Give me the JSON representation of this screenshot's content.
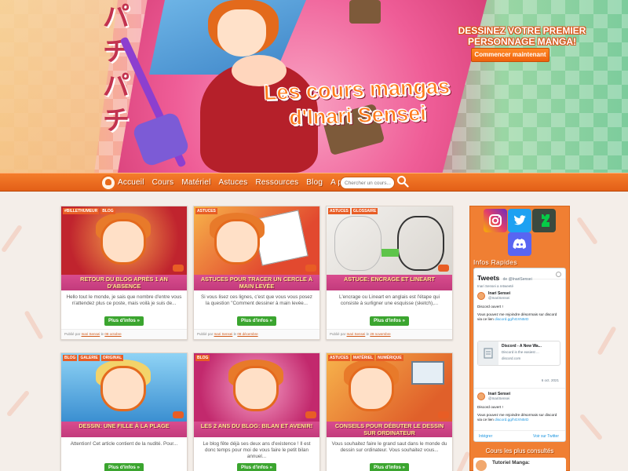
{
  "hero": {
    "title_line1": "Les cours mangas",
    "title_line2": "d'Inari Sensei",
    "cta_text_line1": "DESSINEZ VOTRE PREMIER",
    "cta_text_line2": "PERSONNAGE MANGA!",
    "cta_button": "Commencer maintenant",
    "kana": "パチパチ"
  },
  "nav": {
    "items": [
      "Accueil",
      "Cours",
      "Matériel",
      "Astuces",
      "Ressources",
      "Blog",
      "A propos"
    ],
    "search_placeholder": "Chercher un cours..."
  },
  "posts": [
    {
      "tags": [
        "#BILLETHUMEUR",
        "BLOG"
      ],
      "title": "Retour du blog après 1 an d'absence",
      "excerpt": "Hello tout le monde, je sais que nombre d'entre vous n'attendez plus ce poste, mais voilà je suis de...",
      "more": "Plus d'infos »",
      "meta_prefix": "Publié par",
      "author": "Inari Sensei",
      "meta_sep": "le",
      "date": "08 octobre",
      "colors": {
        "bg1": "#f5a04a",
        "bg2": "#c0242e"
      }
    },
    {
      "tags": [
        "ASTUCES"
      ],
      "title": "Astuces pour tracer un cercle à main levée",
      "excerpt": "Si vous lisez ces lignes, c'est que vous vous posez la question \"Comment dessiner à main levée...",
      "more": "Plus d'infos »",
      "meta_prefix": "Publié par",
      "author": "Inari Sensei",
      "meta_sep": "le",
      "date": "08 décembre",
      "colors": {
        "bg1": "#f7b34a",
        "bg2": "#e2492f"
      }
    },
    {
      "tags": [
        "ASTUCES",
        "GLOSSAIRE"
      ],
      "title": "Astuce: Encrage et Lineart",
      "excerpt": "L'encrage ou Lineart en anglais est l'étape qui consiste à surligner une esquisse (sketch),...",
      "more": "Plus d'infos »",
      "meta_prefix": "Publié par",
      "author": "Inari Sensei",
      "meta_sep": "le",
      "date": "29 novembre",
      "colors": {
        "bg1": "#f3f1ee",
        "bg2": "#d9d5cf"
      }
    },
    {
      "tags": [
        "BLOG",
        "GALERIE",
        "ORIGINAL"
      ],
      "title": "Dessin: Une fille à la plage",
      "excerpt": "Attention! Cet article contient de la nudité. Pour...",
      "more": "Plus d'infos »",
      "meta_prefix": "",
      "author": "",
      "meta_sep": "",
      "date": "",
      "colors": {
        "bg1": "#6cc3f0",
        "bg2": "#2f85c9"
      }
    },
    {
      "tags": [
        "BLOG"
      ],
      "title": "Les 2 ans du blog: bilan et avenir!",
      "excerpt": "Le blog fête déjà ses deux ans d'existence ! Il est donc temps pour moi de vous faire le petit bilan annuel...",
      "more": "Plus d'infos »",
      "meta_prefix": "",
      "author": "",
      "meta_sep": "",
      "date": "",
      "colors": {
        "bg1": "#f37ab2",
        "bg2": "#c2296d"
      }
    },
    {
      "tags": [
        "ASTUCES",
        "MATÉRIEL",
        "NUMÉRIQUE"
      ],
      "title": "Conseils pour débuter le dessin sur ordinateur",
      "excerpt": "Vous souhaitez faire le grand saut dans le monde du dessin sur ordinateur. Vous souhaitez vous...",
      "more": "Plus d'infos »",
      "meta_prefix": "",
      "author": "",
      "meta_sep": "",
      "date": "",
      "colors": {
        "bg1": "#f7b44c",
        "bg2": "#e0602a"
      }
    }
  ],
  "sidebar": {
    "quick_info": "Infos Rapides",
    "tweets_title": "Tweets",
    "tweets_by": "de @InariSensei",
    "retweet_label": "Inari Sensei a retweeté",
    "tweet1": {
      "name": "Inari Sensei",
      "handle": "@InariSensei",
      "text1": "Discord ouvert !",
      "text2": "Vous pouvez me rejoindre désormais sur discord via ce lien",
      "link": "discord.gg/hGXN5rD",
      "card_title": "Discord - A New Wa...",
      "card_sub": "Discord is the easiest ...",
      "card_domain": "discord.com",
      "date": "6 oct. 2021"
    },
    "tweet2": {
      "name": "Inari Sensei",
      "handle": "@InariSensei",
      "text1": "Discord ouvert !",
      "text2": "Vous pouvez me rejoindre désormais sur discord via ce lien",
      "link": "discord.gg/hGXN5rD"
    },
    "embed_label": "Intégrer",
    "view_on_twitter": "Voir sur Twitter",
    "popular_heading": "Cours les plus consultés",
    "popular_item": "Tutoriel Manga:"
  },
  "colors": {
    "accent": "#e8651d",
    "card_title": "#c23b7c",
    "button_green": "#3ba52f"
  }
}
